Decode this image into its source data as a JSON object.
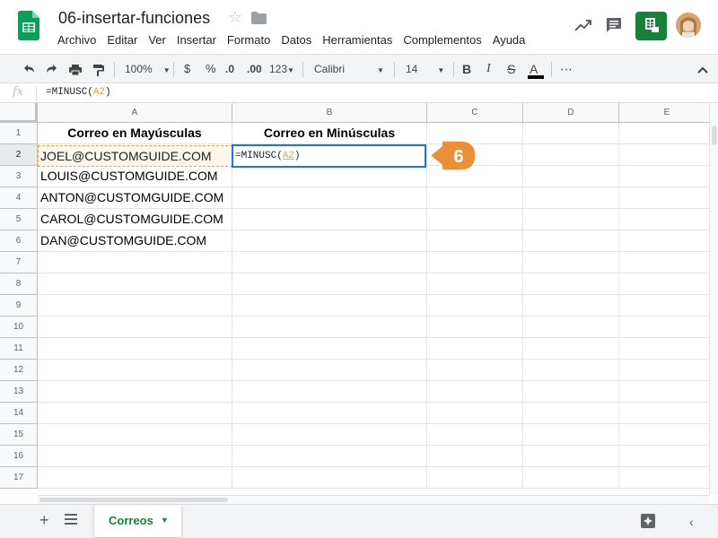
{
  "document": {
    "title": "06-insertar-funciones"
  },
  "menu": [
    "Archivo",
    "Editar",
    "Ver",
    "Insertar",
    "Formato",
    "Datos",
    "Herramientas",
    "Complementos",
    "Ayuda"
  ],
  "toolbar": {
    "zoom": "100%",
    "currency": "$",
    "percent": "%",
    "decrease_decimals": ".0",
    "increase_decimals": ".00",
    "more_formats": "123",
    "font": "Calibri",
    "font_size": "14",
    "bold": "B",
    "italic": "I",
    "strikethrough": "S",
    "text_color": "A",
    "more": "⋯"
  },
  "formula_bar": {
    "fx": "fx",
    "formula_prefix": "=MINUSC(",
    "formula_ref": "A2",
    "formula_suffix": ")"
  },
  "columns": [
    "A",
    "B",
    "C",
    "D",
    "E"
  ],
  "rows": [
    {
      "num": "1",
      "a": "Correo en Mayúsculas",
      "b": "Correo en Minúsculas"
    },
    {
      "num": "2",
      "a": "JOEL@CUSTOMGUIDE.COM",
      "b": ""
    },
    {
      "num": "3",
      "a": "LOUIS@CUSTOMGUIDE.COM",
      "b": ""
    },
    {
      "num": "4",
      "a": "ANTON@CUSTOMGUIDE.COM",
      "b": ""
    },
    {
      "num": "5",
      "a": "CAROL@CUSTOMGUIDE.COM",
      "b": ""
    },
    {
      "num": "6",
      "a": "DAN@CUSTOMGUIDE.COM",
      "b": ""
    },
    {
      "num": "7",
      "a": "",
      "b": ""
    },
    {
      "num": "8",
      "a": "",
      "b": ""
    },
    {
      "num": "9",
      "a": "",
      "b": ""
    },
    {
      "num": "10",
      "a": "",
      "b": ""
    },
    {
      "num": "11",
      "a": "",
      "b": ""
    },
    {
      "num": "12",
      "a": "",
      "b": ""
    },
    {
      "num": "13",
      "a": "",
      "b": ""
    },
    {
      "num": "14",
      "a": "",
      "b": ""
    },
    {
      "num": "15",
      "a": "",
      "b": ""
    },
    {
      "num": "16",
      "a": "",
      "b": ""
    },
    {
      "num": "17",
      "a": "",
      "b": ""
    }
  ],
  "edit_cell": {
    "prefix": "=MINUSC(",
    "ref": "A2",
    "suffix": ")"
  },
  "callout": {
    "step": "6",
    "color": "#e8913a"
  },
  "sheet_tab": {
    "label": "Correos"
  },
  "colors": {
    "accent_green": "#188038",
    "selection_blue": "#1a73e8",
    "reference_orange": "#e8a33d"
  }
}
